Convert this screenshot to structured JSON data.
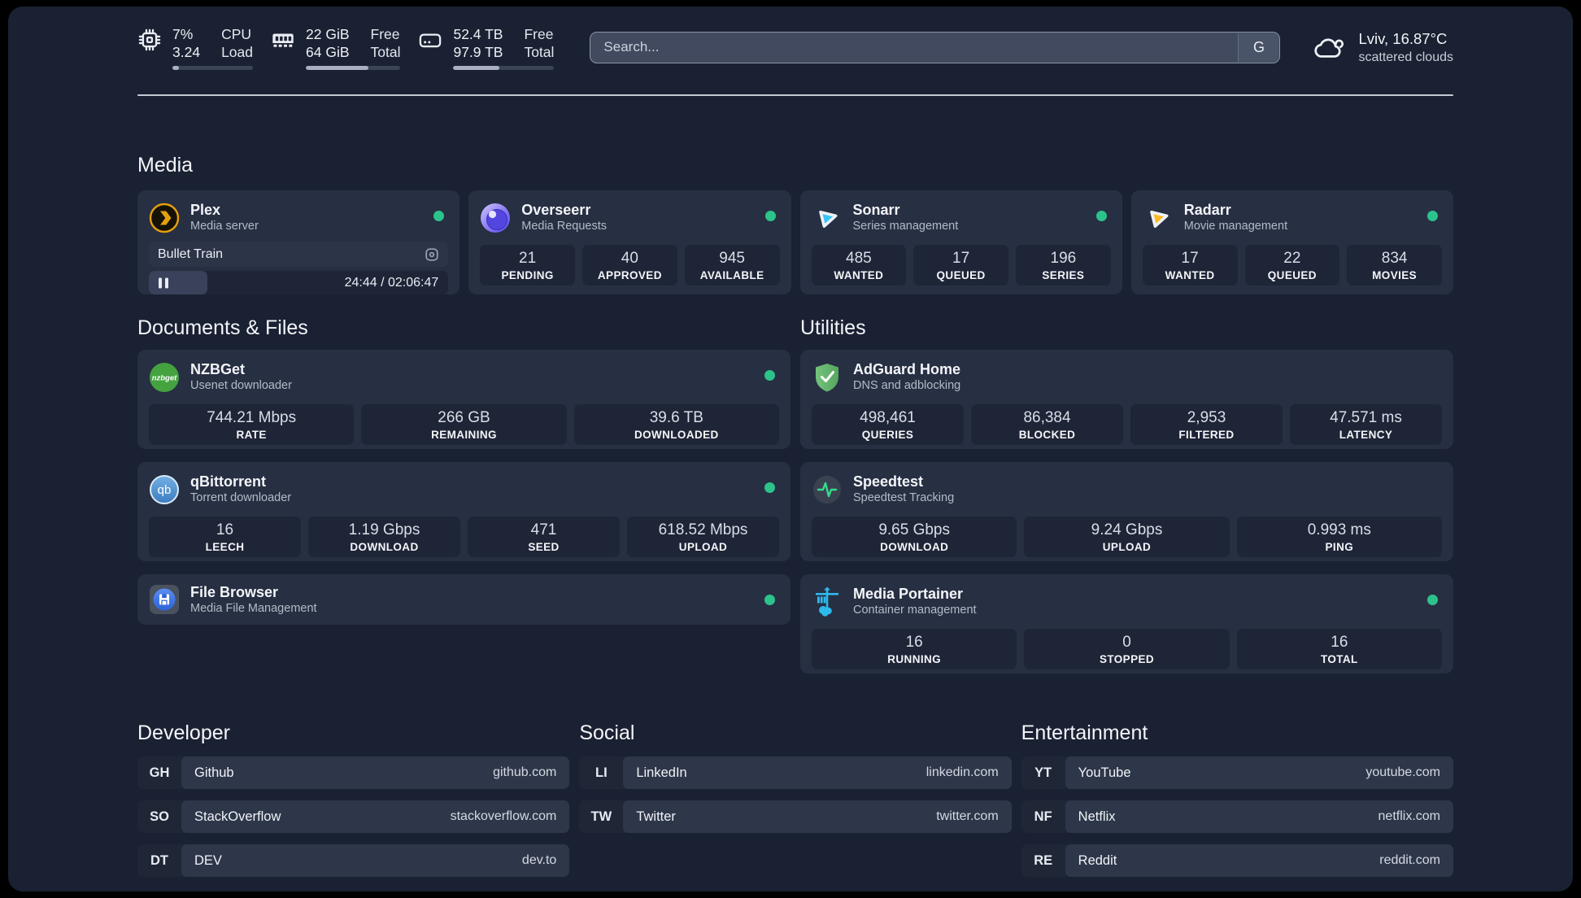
{
  "colors": {
    "online": "#2cc38a"
  },
  "topbar": {
    "cpu": {
      "value1": "7%",
      "value2": "3.24",
      "label1": "CPU",
      "label2": "Load",
      "progress": 8
    },
    "ram": {
      "value1": "22 GiB",
      "value2": "64 GiB",
      "label1": "Free",
      "label2": "Total",
      "progress": 66
    },
    "disk": {
      "value1": "52.4 TB",
      "value2": "97.9 TB",
      "label1": "Free",
      "label2": "Total",
      "progress": 46
    },
    "search": {
      "placeholder": "Search...",
      "button_label": "G"
    },
    "weather": {
      "line1": "Lviv, 16.87°C",
      "line2": "scattered clouds"
    }
  },
  "sections": {
    "media": {
      "title": "Media",
      "plex": {
        "name": "Plex",
        "subtitle": "Media server",
        "now_playing": "Bullet Train",
        "time": "24:44 / 02:06:47",
        "progress": 19.5
      },
      "overseerr": {
        "name": "Overseerr",
        "subtitle": "Media Requests",
        "stats": [
          {
            "value": "21",
            "label": "PENDING"
          },
          {
            "value": "40",
            "label": "APPROVED"
          },
          {
            "value": "945",
            "label": "AVAILABLE"
          }
        ]
      },
      "sonarr": {
        "name": "Sonarr",
        "subtitle": "Series management",
        "stats": [
          {
            "value": "485",
            "label": "WANTED"
          },
          {
            "value": "17",
            "label": "QUEUED"
          },
          {
            "value": "196",
            "label": "SERIES"
          }
        ]
      },
      "radarr": {
        "name": "Radarr",
        "subtitle": "Movie management",
        "stats": [
          {
            "value": "17",
            "label": "WANTED"
          },
          {
            "value": "22",
            "label": "QUEUED"
          },
          {
            "value": "834",
            "label": "MOVIES"
          }
        ]
      }
    },
    "documents": {
      "title": "Documents & Files",
      "nzbget": {
        "name": "NZBGet",
        "subtitle": "Usenet downloader",
        "stats": [
          {
            "value": "744.21 Mbps",
            "label": "RATE"
          },
          {
            "value": "266 GB",
            "label": "REMAINING"
          },
          {
            "value": "39.6 TB",
            "label": "DOWNLOADED"
          }
        ]
      },
      "qbittorrent": {
        "name": "qBittorrent",
        "subtitle": "Torrent downloader",
        "stats": [
          {
            "value": "16",
            "label": "LEECH"
          },
          {
            "value": "1.19 Gbps",
            "label": "DOWNLOAD"
          },
          {
            "value": "471",
            "label": "SEED"
          },
          {
            "value": "618.52 Mbps",
            "label": "UPLOAD"
          }
        ]
      },
      "filebrowser": {
        "name": "File Browser",
        "subtitle": "Media File Management"
      }
    },
    "utilities": {
      "title": "Utilities",
      "adguard": {
        "name": "AdGuard Home",
        "subtitle": "DNS and adblocking",
        "stats": [
          {
            "value": "498,461",
            "label": "QUERIES"
          },
          {
            "value": "86,384",
            "label": "BLOCKED"
          },
          {
            "value": "2,953",
            "label": "FILTERED"
          },
          {
            "value": "47.571 ms",
            "label": "LATENCY"
          }
        ]
      },
      "speedtest": {
        "name": "Speedtest",
        "subtitle": "Speedtest Tracking",
        "stats": [
          {
            "value": "9.65 Gbps",
            "label": "DOWNLOAD"
          },
          {
            "value": "9.24 Gbps",
            "label": "UPLOAD"
          },
          {
            "value": "0.993 ms",
            "label": "PING"
          }
        ]
      },
      "portainer": {
        "name": "Media Portainer",
        "subtitle": "Container management",
        "stats": [
          {
            "value": "16",
            "label": "RUNNING"
          },
          {
            "value": "0",
            "label": "STOPPED"
          },
          {
            "value": "16",
            "label": "TOTAL"
          }
        ]
      }
    }
  },
  "links": {
    "developer": {
      "title": "Developer",
      "items": [
        {
          "tag": "GH",
          "name": "Github",
          "domain": "github.com"
        },
        {
          "tag": "SO",
          "name": "StackOverflow",
          "domain": "stackoverflow.com"
        },
        {
          "tag": "DT",
          "name": "DEV",
          "domain": "dev.to"
        }
      ]
    },
    "social": {
      "title": "Social",
      "items": [
        {
          "tag": "LI",
          "name": "LinkedIn",
          "domain": "linkedin.com"
        },
        {
          "tag": "TW",
          "name": "Twitter",
          "domain": "twitter.com"
        }
      ]
    },
    "entertainment": {
      "title": "Entertainment",
      "items": [
        {
          "tag": "YT",
          "name": "YouTube",
          "domain": "youtube.com"
        },
        {
          "tag": "NF",
          "name": "Netflix",
          "domain": "netflix.com"
        },
        {
          "tag": "RE",
          "name": "Reddit",
          "domain": "reddit.com"
        }
      ]
    }
  }
}
